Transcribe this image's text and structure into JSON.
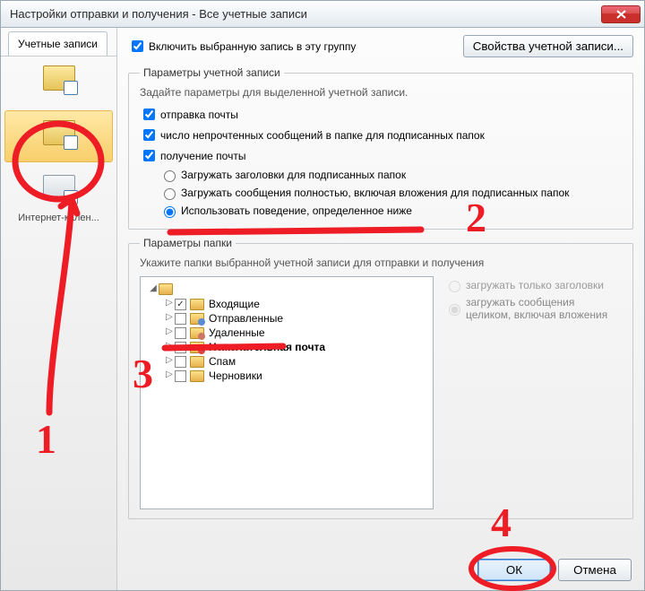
{
  "window": {
    "title": "Настройки отправки и получения - Все учетные записи"
  },
  "sidebar": {
    "tab": "Учетные записи",
    "items": [
      "",
      "",
      "Интернет-кален..."
    ]
  },
  "top": {
    "include_label": "Включить выбранную запись в эту группу",
    "props_button": "Свойства учетной записи..."
  },
  "acct_params": {
    "legend": "Параметры учетной записи",
    "hint": "Задайте параметры для выделенной учетной записи.",
    "send": "отправка почты",
    "unread": "число непрочтенных сообщений в папке для подписанных папок",
    "receive": "получение почты",
    "r1": "Загружать заголовки для подписанных папок",
    "r2": "Загружать сообщения полностью, включая вложения для подписанных папок",
    "r3": "Использовать поведение, определенное ниже"
  },
  "folder_params": {
    "legend": "Параметры папки",
    "hint": "Укажите папки выбранной учетной записи для отправки и получения",
    "root": "",
    "folders": [
      {
        "label": "Входящие",
        "checked": true,
        "kind": "in"
      },
      {
        "label": "Отправленные",
        "checked": false,
        "kind": "sent"
      },
      {
        "label": "Удаленные",
        "checked": false,
        "kind": "del"
      },
      {
        "label": "Нежелательная почта",
        "checked": false,
        "kind": "junk",
        "bold": true
      },
      {
        "label": "Спам",
        "checked": false,
        "kind": "plain"
      },
      {
        "label": "Черновики",
        "checked": false,
        "kind": "plain"
      }
    ],
    "opt1": "загружать только заголовки",
    "opt2": "загружать сообщения целиком, включая вложения"
  },
  "footer": {
    "ok": "ОК",
    "cancel": "Отмена"
  },
  "annotations": {
    "n1": "1",
    "n2": "2",
    "n3": "3",
    "n4": "4"
  }
}
